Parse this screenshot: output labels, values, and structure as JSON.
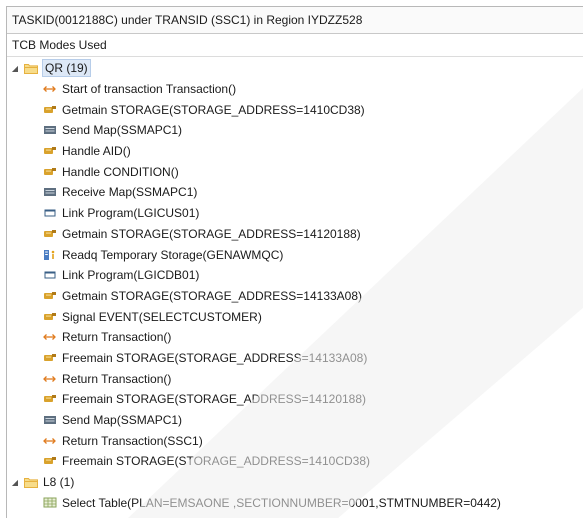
{
  "title": "TASKID(0012188C) under TRANSID (SSC1) in Region IYDZZ528",
  "column_header": "TCB Modes Used",
  "colors": {
    "folder": "#e6b13f",
    "getmain": "#d9a22c",
    "map": "#5e6f80",
    "link": "#3a5f86",
    "arrow": "#e07b1e",
    "readq": "#4a7cc2",
    "table": "#8aa35a"
  },
  "groups": [
    {
      "label": "QR (19)",
      "icon": "folder-icon",
      "items": [
        {
          "label": "Start of transaction Transaction()",
          "icon": "transaction-arrow-icon"
        },
        {
          "label": "Getmain STORAGE(STORAGE_ADDRESS=1410CD38)",
          "icon": "storage-icon"
        },
        {
          "label": "Send Map(SSMAPC1)",
          "icon": "map-icon"
        },
        {
          "label": "Handle AID()",
          "icon": "storage-icon"
        },
        {
          "label": "Handle CONDITION()",
          "icon": "storage-icon"
        },
        {
          "label": "Receive Map(SSMAPC1)",
          "icon": "map-icon"
        },
        {
          "label": "Link Program(LGICUS01)",
          "icon": "program-icon"
        },
        {
          "label": "Getmain STORAGE(STORAGE_ADDRESS=14120188)",
          "icon": "storage-icon"
        },
        {
          "label": "Readq Temporary Storage(GENAWMQC)",
          "icon": "queue-icon"
        },
        {
          "label": "Link Program(LGICDB01)",
          "icon": "program-icon"
        },
        {
          "label": "Getmain STORAGE(STORAGE_ADDRESS=14133A08)",
          "icon": "storage-icon"
        },
        {
          "label": "Signal EVENT(SELECTCUSTOMER)",
          "icon": "storage-icon"
        },
        {
          "label": "Return Transaction()",
          "icon": "transaction-arrow-icon"
        },
        {
          "label": "Freemain STORAGE(STORAGE_ADDRESS=14133A08)",
          "icon": "storage-icon"
        },
        {
          "label": "Return Transaction()",
          "icon": "transaction-arrow-icon"
        },
        {
          "label": "Freemain STORAGE(STORAGE_ADDRESS=14120188)",
          "icon": "storage-icon"
        },
        {
          "label": "Send Map(SSMAPC1)",
          "icon": "map-icon"
        },
        {
          "label": "Return Transaction(SSC1)",
          "icon": "transaction-arrow-icon"
        },
        {
          "label": "Freemain STORAGE(STORAGE_ADDRESS=1410CD38)",
          "icon": "storage-icon"
        }
      ]
    },
    {
      "label": "L8 (1)",
      "icon": "folder-icon",
      "items": [
        {
          "label": "Select Table(PLAN=EMSAONE ,SECTIONNUMBER=0001,STMTNUMBER=0442)",
          "icon": "table-icon"
        }
      ]
    }
  ]
}
